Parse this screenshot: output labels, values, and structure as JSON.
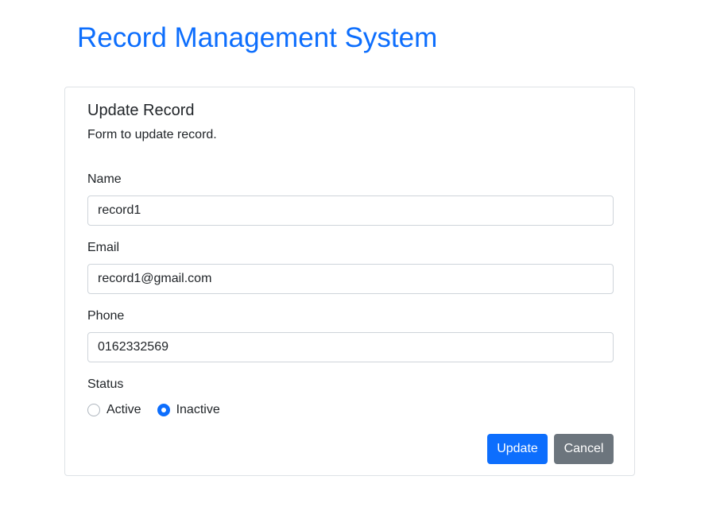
{
  "app": {
    "title": "Record Management System"
  },
  "form": {
    "title": "Update Record",
    "subtitle": "Form to update record.",
    "fields": {
      "name": {
        "label": "Name",
        "value": "record1"
      },
      "email": {
        "label": "Email",
        "value": "record1@gmail.com"
      },
      "phone": {
        "label": "Phone",
        "value": "0162332569"
      }
    },
    "status": {
      "label": "Status",
      "options": [
        {
          "label": "Active",
          "checked": false
        },
        {
          "label": "Inactive",
          "checked": true
        }
      ]
    },
    "buttons": {
      "update_label": "Update",
      "cancel_label": "Cancel"
    }
  },
  "colors": {
    "accent": "#0d6efd",
    "secondary": "#6c757d",
    "border": "#dee2e6",
    "text": "#212529"
  }
}
